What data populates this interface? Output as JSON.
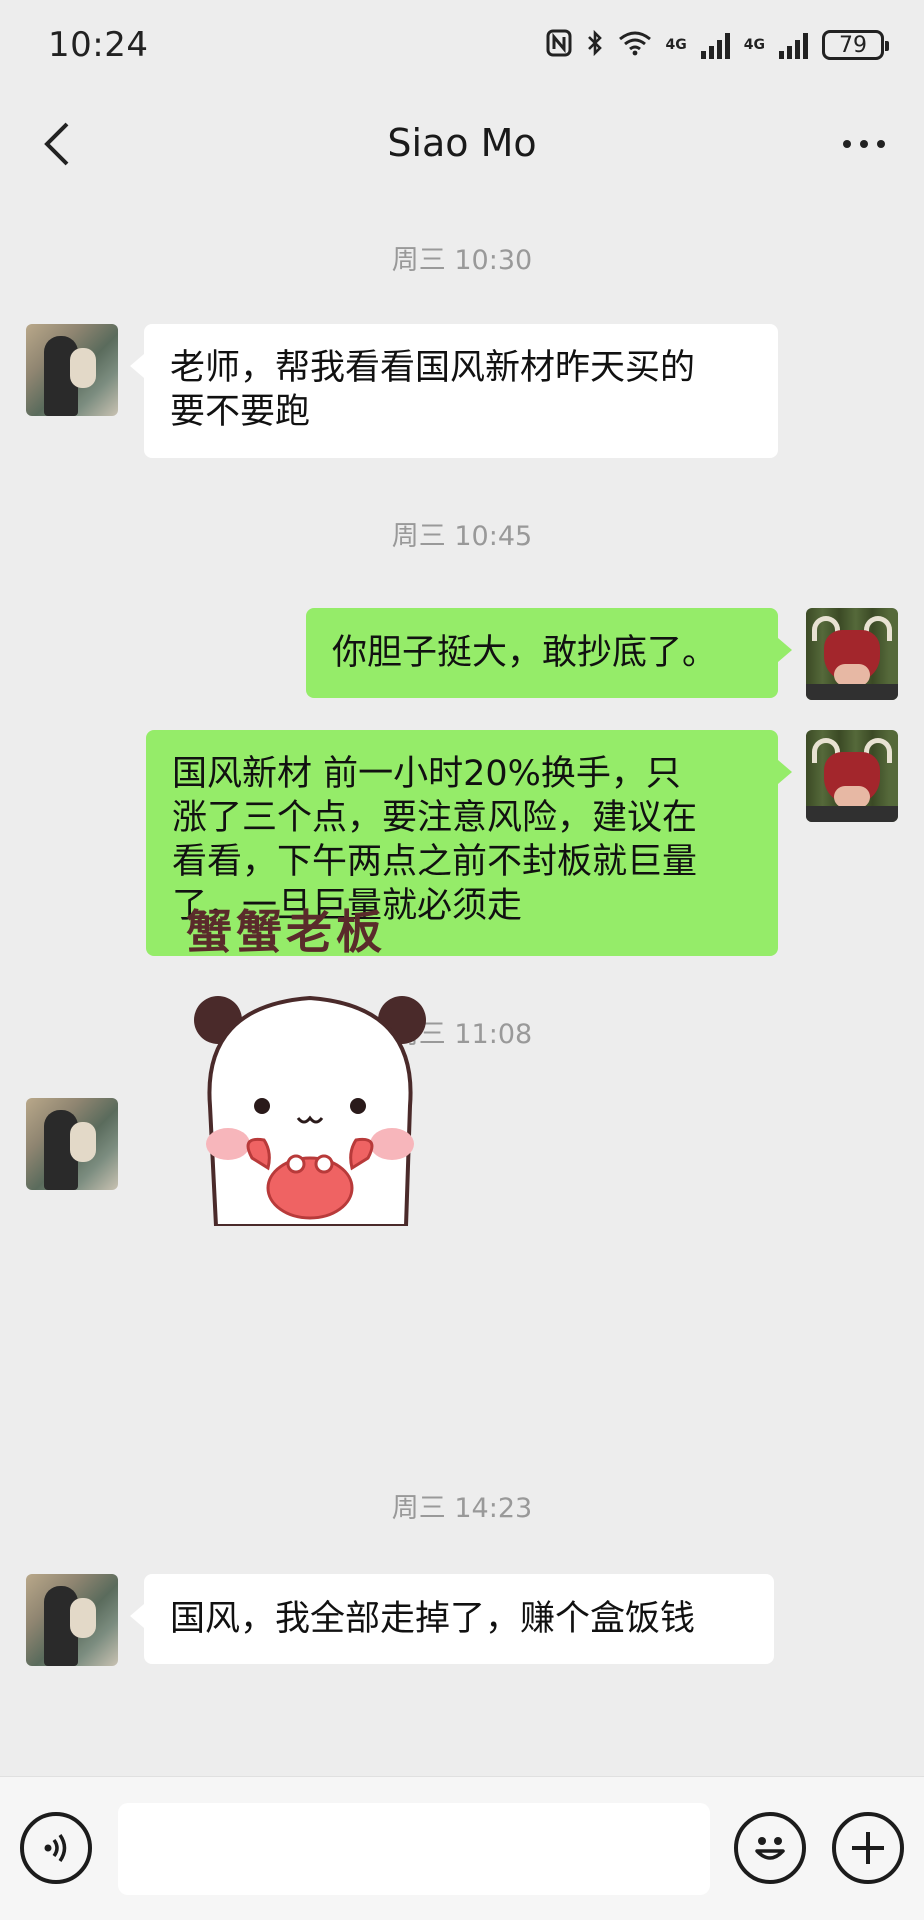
{
  "status_bar": {
    "time": "10:24",
    "network_1": "4G",
    "network_2": "4G",
    "battery": "79"
  },
  "header": {
    "title": "Siao Mo"
  },
  "messages": [
    {
      "type": "time",
      "text": "周三 10:30"
    },
    {
      "type": "incoming",
      "lines": [
        "老师，帮我看看国风新材昨天买的",
        "要不要跑"
      ]
    },
    {
      "type": "time",
      "text": "周三 10:45"
    },
    {
      "type": "outgoing",
      "lines": [
        "你胆子挺大，敢抄底了。"
      ]
    },
    {
      "type": "outgoing",
      "lines": [
        "国风新材  前一小时20%换手，只",
        "涨了三个点，要注意风险，建议在",
        "看看，下午两点之前不封板就巨量",
        "了，一旦巨量就必须走"
      ]
    },
    {
      "type": "time",
      "text": "周三 11:08"
    },
    {
      "type": "sticker",
      "text": "蟹蟹老板"
    },
    {
      "type": "time",
      "text": "周三 14:23"
    },
    {
      "type": "incoming",
      "lines": [
        "国风，我全部走掉了，赚个盒饭钱"
      ]
    }
  ],
  "input_bar": {
    "placeholder": ""
  },
  "colors": {
    "background": "#ededed",
    "outgoing_bubble": "#95ec69",
    "incoming_bubble": "#ffffff",
    "timestamp": "#999999"
  },
  "icons": {
    "back": "chevron-left-icon",
    "more": "more-dots-icon",
    "voice": "voice-icon",
    "emoji": "emoji-icon",
    "plus": "plus-icon"
  }
}
